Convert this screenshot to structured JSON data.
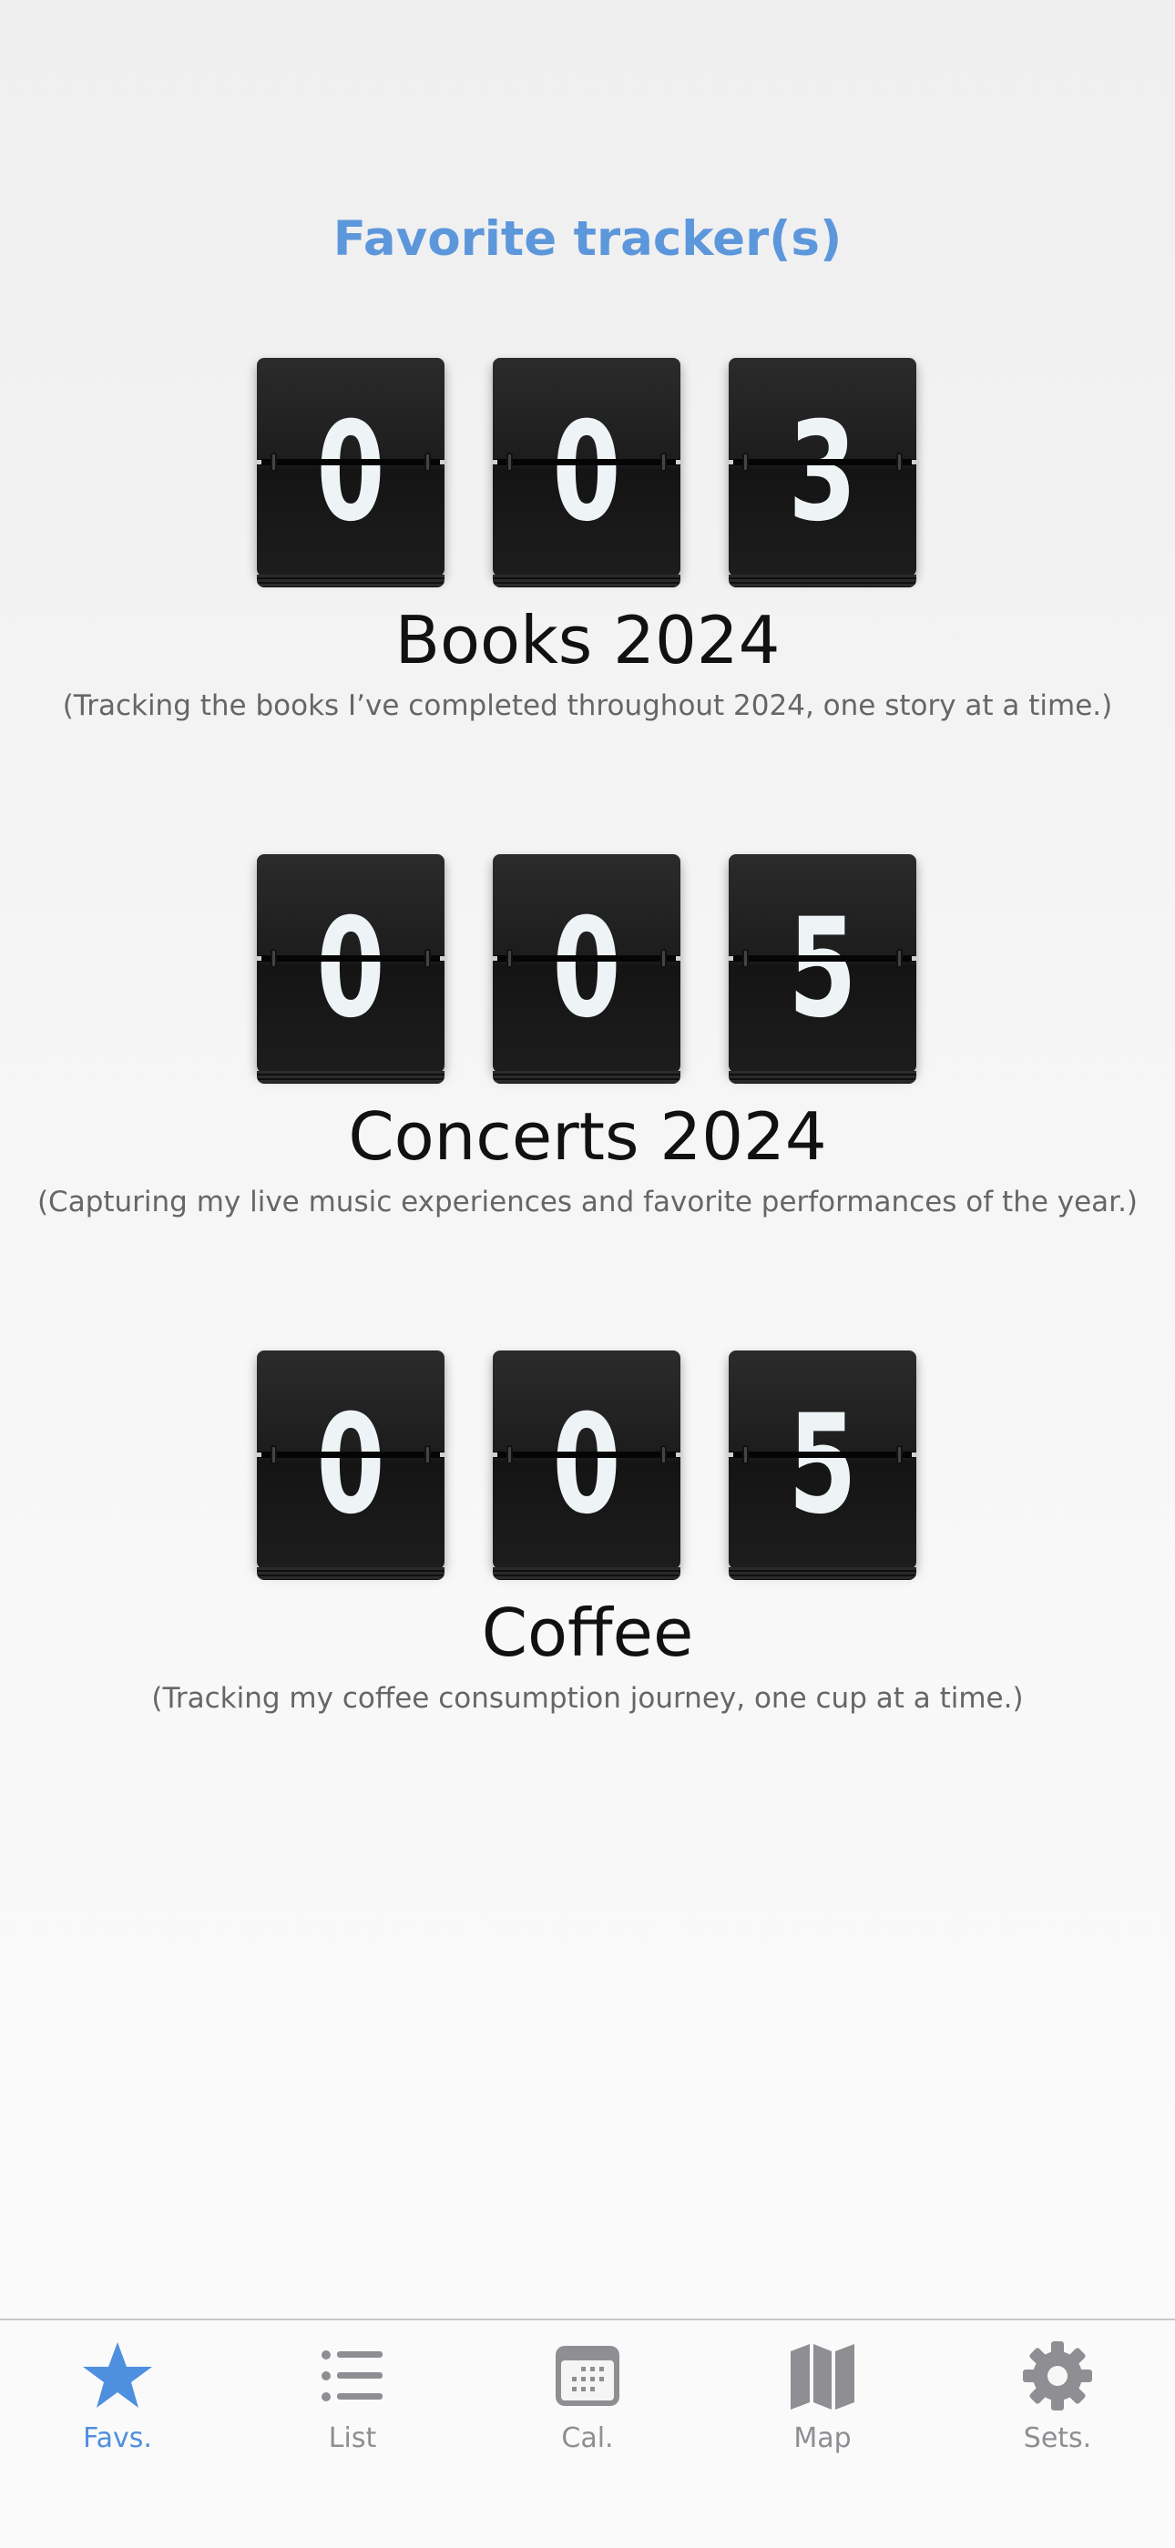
{
  "header": {
    "title": "Favorite tracker(s)"
  },
  "trackers": [
    {
      "digits": [
        "0",
        "0",
        "3"
      ],
      "name": "Books 2024",
      "description": "(Tracking the books I’ve completed throughout 2024, one story at a time.)"
    },
    {
      "digits": [
        "0",
        "0",
        "5"
      ],
      "name": "Concerts 2024",
      "description": "(Capturing my live music experiences and favorite performances of the year.)"
    },
    {
      "digits": [
        "0",
        "0",
        "5"
      ],
      "name": "Coffee",
      "description": "(Tracking my coffee consumption journey, one cup at a time.)"
    }
  ],
  "tabbar": {
    "active": "Favs.",
    "tabs": [
      {
        "label": "Favs.",
        "icon": "star-icon",
        "color": "#4f8fdf"
      },
      {
        "label": "List",
        "icon": "list-icon",
        "color": "#8e8e93"
      },
      {
        "label": "Cal.",
        "icon": "calendar-icon",
        "color": "#8e8e93"
      },
      {
        "label": "Map",
        "icon": "map-icon",
        "color": "#8e8e93"
      },
      {
        "label": "Sets.",
        "icon": "gear-icon",
        "color": "#8e8e93"
      }
    ]
  }
}
